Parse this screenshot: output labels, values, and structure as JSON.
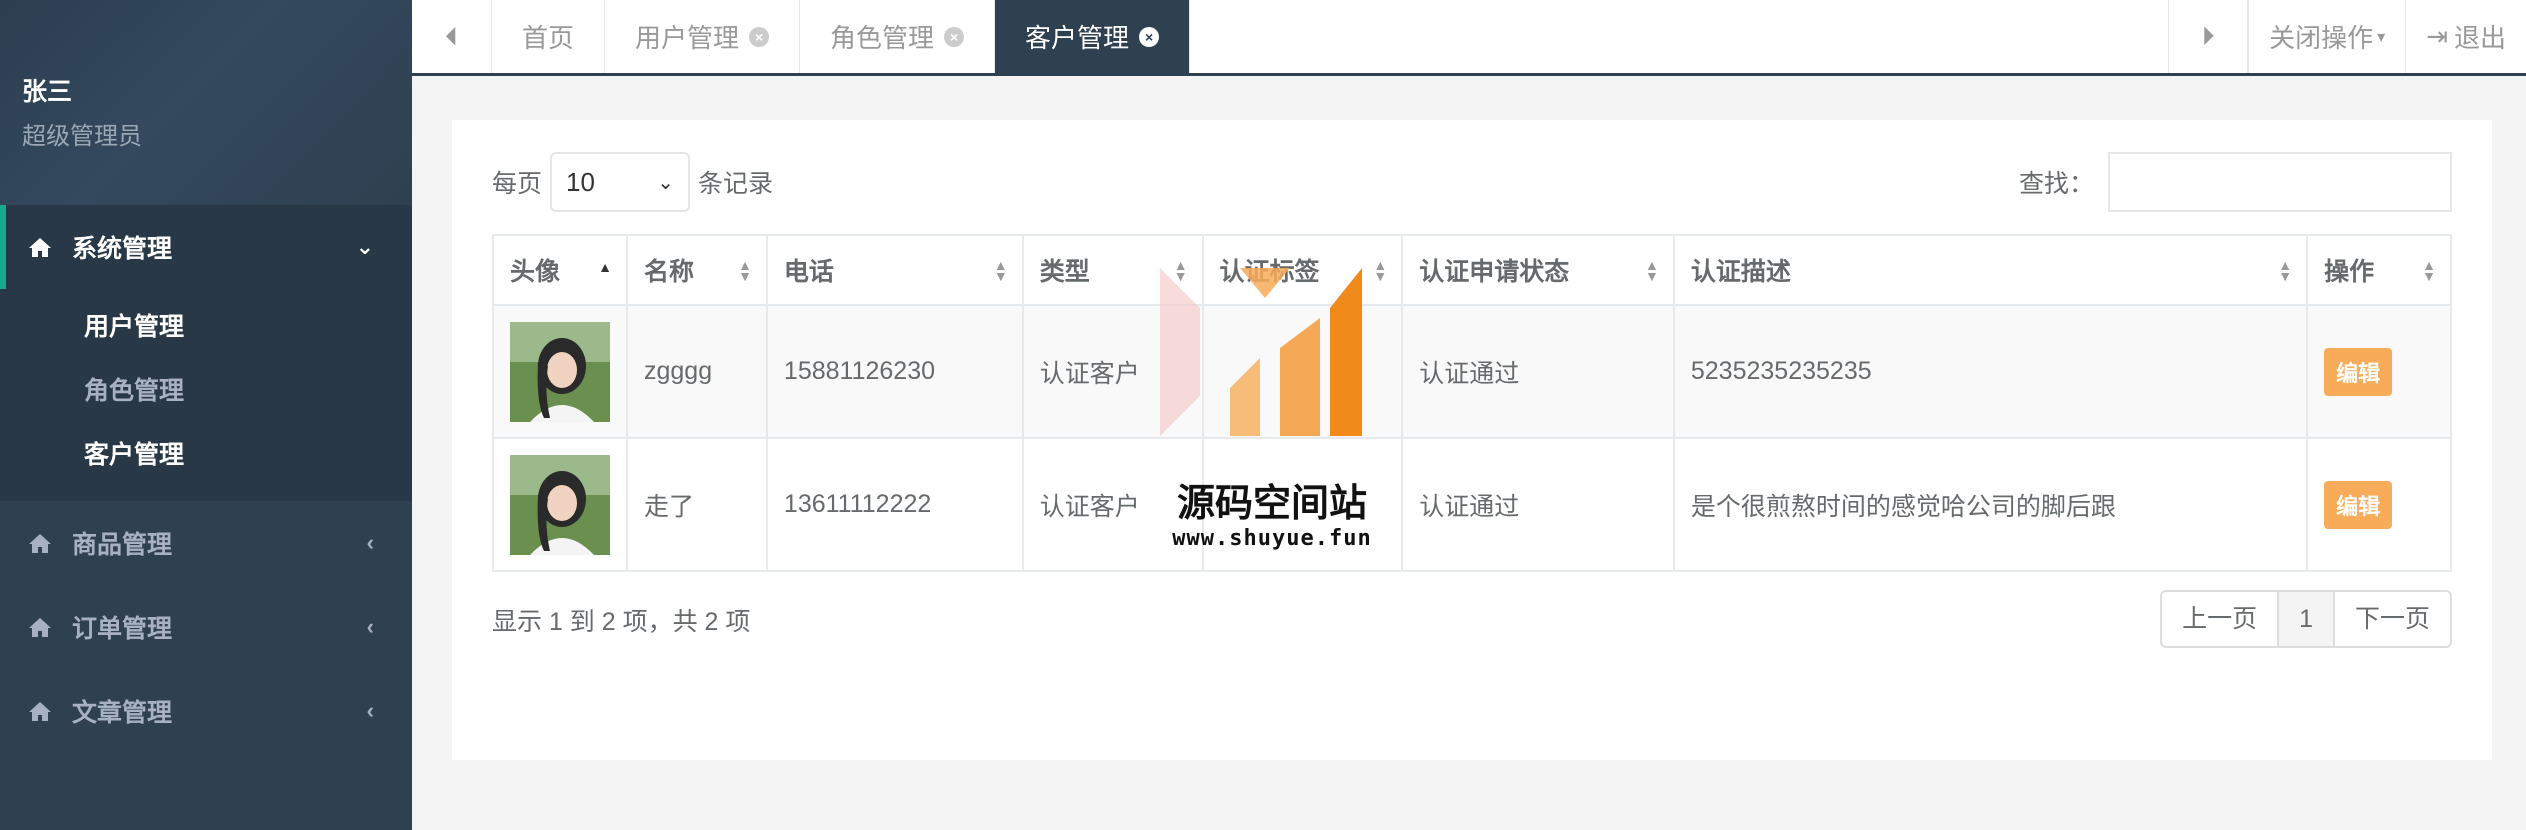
{
  "user": {
    "name": "张三",
    "role": "超级管理员"
  },
  "sidebar": {
    "groups": [
      {
        "label": "系统管理",
        "items": [
          "用户管理",
          "角色管理",
          "客户管理"
        ]
      },
      {
        "label": "商品管理"
      },
      {
        "label": "订单管理"
      },
      {
        "label": "文章管理"
      }
    ]
  },
  "tabs": [
    "首页",
    "用户管理",
    "角色管理",
    "客户管理"
  ],
  "topbar": {
    "close_ops": "关闭操作",
    "logout": "退出"
  },
  "toolbar": {
    "per_page_prefix": "每页",
    "per_page_value": "10",
    "per_page_suffix": "条记录",
    "search_label": "查找："
  },
  "table": {
    "headers": [
      "头像",
      "名称",
      "电话",
      "类型",
      "认证标签",
      "认证申请状态",
      "认证描述",
      "操作"
    ],
    "rows": [
      {
        "name": "zgggg",
        "phone": "15881126230",
        "type": "认证客户",
        "tag": "",
        "status": "认证通过",
        "desc": "5235235235235",
        "action": "编辑"
      },
      {
        "name": "走了",
        "phone": "13611112222",
        "type": "认证客户",
        "tag": "",
        "status": "认证通过",
        "desc": "是个很煎熬时间的感觉哈公司的脚后跟",
        "action": "编辑"
      }
    ]
  },
  "footer": {
    "info": "显示 1 到 2 项，共 2 项",
    "prev": "上一页",
    "page": "1",
    "next": "下一页"
  },
  "watermark": {
    "text": "源码空间站",
    "url": "www.shuyue.fun"
  },
  "colors": {
    "sidebar": "#2f4050",
    "active_tab": "#2f4050",
    "edit_button": "#f8ac59",
    "accent": "#19aa8d"
  }
}
